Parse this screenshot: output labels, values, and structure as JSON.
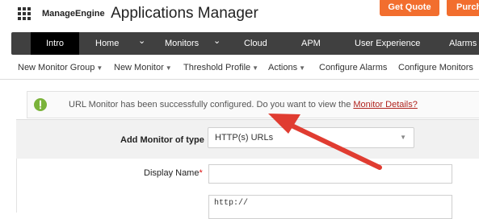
{
  "header": {
    "brand_small": "ManageEngine",
    "brand_big": "Applications Manager",
    "get_quote": "Get Quote",
    "purchase": "Purch"
  },
  "nav": {
    "items": [
      {
        "label": "Intro",
        "active": true
      },
      {
        "label": "Home",
        "active": false
      },
      {
        "label": "⌄",
        "active": false
      },
      {
        "label": "Monitors",
        "active": false
      },
      {
        "label": "⌄",
        "active": false
      },
      {
        "label": "Cloud",
        "active": false
      },
      {
        "label": "APM",
        "active": false
      },
      {
        "label": "User Experience",
        "active": false
      },
      {
        "label": "Alarms",
        "active": false
      }
    ]
  },
  "subnav": {
    "items": [
      {
        "label": "New Monitor Group",
        "caret": true
      },
      {
        "label": "New Monitor",
        "caret": true
      },
      {
        "label": "Threshold Profile",
        "caret": true
      },
      {
        "label": "Actions",
        "caret": true
      },
      {
        "label": "Configure Alarms",
        "caret": false
      },
      {
        "label": "Configure Monitors",
        "caret": false
      }
    ]
  },
  "message": {
    "text": "URL Monitor has been successfully configured. Do you want to view the ",
    "link": "Monitor Details?"
  },
  "form": {
    "type_label": "Add Monitor of type",
    "type_value": "HTTP(s) URLs",
    "display_name_label": "Display Name",
    "required_mark": "*",
    "url_value": "http://"
  },
  "colors": {
    "accent_orange": "#f26e2e",
    "nav_dark": "#404040",
    "success_green": "#7ab33a",
    "annotation_red": "#e03c31"
  }
}
